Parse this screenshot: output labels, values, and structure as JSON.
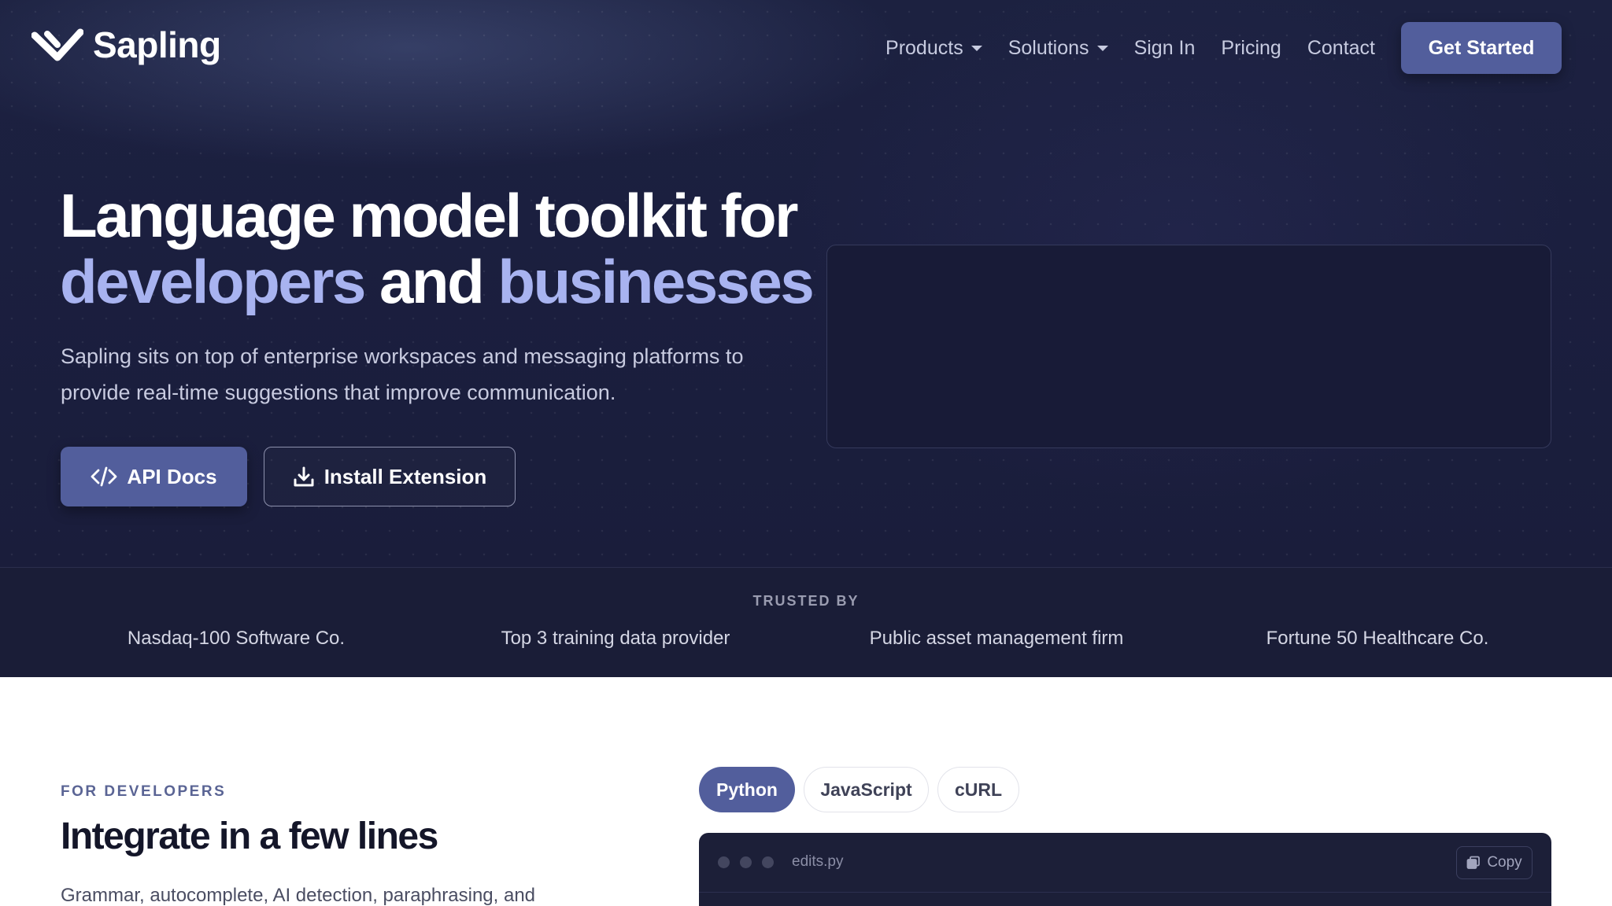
{
  "brand": {
    "name": "Sapling"
  },
  "nav": {
    "items": [
      {
        "label": "Products",
        "dropdown": true
      },
      {
        "label": "Solutions",
        "dropdown": true
      },
      {
        "label": "Sign In",
        "dropdown": false
      },
      {
        "label": "Pricing",
        "dropdown": false
      },
      {
        "label": "Contact",
        "dropdown": false
      }
    ],
    "cta": "Get Started"
  },
  "hero": {
    "headline_line1": "Language model toolkit for",
    "headline_accent1": "developers",
    "headline_mid": "and",
    "headline_accent2": "businesses",
    "subtext_line1": "Sapling sits on top of enterprise workspaces and messaging platforms to",
    "subtext_line2": "provide real-time suggestions that improve communication.",
    "btn_api": "API Docs",
    "btn_install": "Install Extension"
  },
  "trusted": {
    "label": "TRUSTED BY",
    "items": [
      "Nasdaq-100 Software Co.",
      "Top 3 training data provider",
      "Public asset management firm",
      "Fortune 50 Healthcare Co."
    ]
  },
  "developers": {
    "eyebrow": "FOR DEVELOPERS",
    "title": "Integrate in a few lines",
    "text": "Grammar, autocomplete, AI detection, paraphrasing, and",
    "tabs": [
      "Python",
      "JavaScript",
      "cURL"
    ],
    "active_tab": "Python",
    "code": {
      "filename": "edits.py",
      "copy_label": "Copy"
    }
  },
  "colors": {
    "hero_bg": "#1b1f3f",
    "accent_text": "#a8b3f0",
    "primary_button": "#525e9c"
  }
}
